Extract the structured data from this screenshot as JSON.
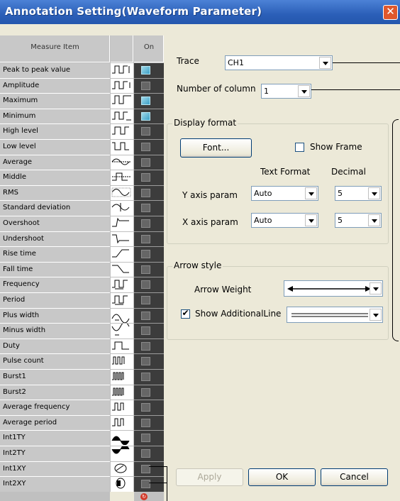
{
  "window": {
    "title": "Annotation Setting(Waveform Parameter)"
  },
  "table": {
    "header_item": "Measure Item",
    "header_on": "On",
    "rows": [
      {
        "label": "Peak to peak value",
        "icon": "peak-to-peak-waveform-icon",
        "on": true
      },
      {
        "label": "Amplitude",
        "icon": "amplitude-waveform-icon",
        "on": false
      },
      {
        "label": "Maximum",
        "icon": "maximum-waveform-icon",
        "on": true
      },
      {
        "label": "Minimum",
        "icon": "minimum-waveform-icon",
        "on": true
      },
      {
        "label": "High level",
        "icon": "high-level-waveform-icon",
        "on": false
      },
      {
        "label": "Low level",
        "icon": "low-level-waveform-icon",
        "on": false
      },
      {
        "label": "Average",
        "icon": "average-waveform-icon",
        "on": false
      },
      {
        "label": "Middle",
        "icon": "middle-waveform-icon",
        "on": false
      },
      {
        "label": "RMS",
        "icon": "rms-waveform-icon",
        "on": false
      },
      {
        "label": "Standard deviation",
        "icon": "standard-deviation-waveform-icon",
        "on": false
      },
      {
        "label": "Overshoot",
        "icon": "overshoot-waveform-icon",
        "on": false
      },
      {
        "label": "Undershoot",
        "icon": "undershoot-waveform-icon",
        "on": false
      },
      {
        "label": "Rise time",
        "icon": "rise-time-waveform-icon",
        "on": false
      },
      {
        "label": "Fall time",
        "icon": "fall-time-waveform-icon",
        "on": false
      },
      {
        "label": "Frequency",
        "icon": "frequency-waveform-icon",
        "on": false
      },
      {
        "label": "Period",
        "icon": "period-waveform-icon",
        "on": false
      },
      {
        "label": "Plus width",
        "icon": "plus-width-waveform-icon",
        "on": false
      },
      {
        "label": "Minus width",
        "icon": "minus-width-waveform-icon",
        "on": false
      },
      {
        "label": "Duty",
        "icon": "duty-waveform-icon",
        "on": false
      },
      {
        "label": "Pulse count",
        "icon": "pulse-count-waveform-icon",
        "on": false
      },
      {
        "label": "Burst1",
        "icon": "burst1-waveform-icon",
        "on": false
      },
      {
        "label": "Burst2",
        "icon": "burst2-waveform-icon",
        "on": false
      },
      {
        "label": "Average frequency",
        "icon": "average-frequency-waveform-icon",
        "on": false
      },
      {
        "label": "Average period",
        "icon": "average-period-waveform-icon",
        "on": false
      },
      {
        "label": "Int1TY",
        "icon": "int1ty-waveform-icon",
        "on": false
      },
      {
        "label": "Int2TY",
        "icon": "int2ty-waveform-icon",
        "on": false
      },
      {
        "label": "Int1XY",
        "icon": "int1xy-waveform-icon",
        "on": false
      },
      {
        "label": "Int2XY",
        "icon": "int2xy-waveform-icon",
        "on": false
      }
    ]
  },
  "trace": {
    "label": "Trace",
    "value": "CH1"
  },
  "columns": {
    "label": "Number of column",
    "value": "1"
  },
  "display_format": {
    "title": "Display format",
    "font_button": "Font...",
    "show_frame": {
      "label": "Show Frame",
      "checked": false
    },
    "text_format_header": "Text Format",
    "decimal_header": "Decimal",
    "y_axis": {
      "label": "Y axis param",
      "text_format": "Auto",
      "decimal": "5"
    },
    "x_axis": {
      "label": "X axis param",
      "text_format": "Auto",
      "decimal": "5"
    }
  },
  "arrow_style": {
    "title": "Arrow style",
    "weight_label": "Arrow Weight",
    "additional_line": {
      "label": "Show AdditionalLine",
      "checked": true
    }
  },
  "buttons": {
    "apply": "Apply",
    "ok": "OK",
    "cancel": "Cancel"
  },
  "colors": {
    "titlebar": "#2b5fb8",
    "dialog_bg": "#ece9d8",
    "table_cell": "#c8c8c8",
    "checkbox_on": "#3b9fc6",
    "checkbox_off": "#666666",
    "close_button": "#e0582d"
  }
}
